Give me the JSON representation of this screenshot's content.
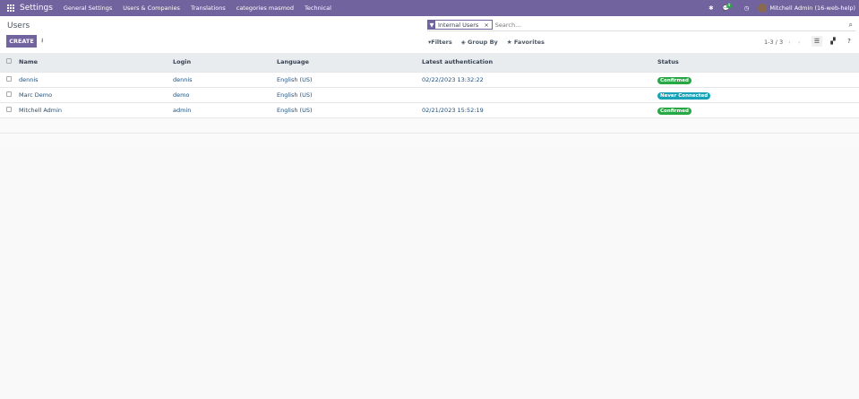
{
  "navbar": {
    "app": "Settings",
    "menus": [
      "General Settings",
      "Users & Companies",
      "Translations",
      "categories masmod",
      "Technical"
    ],
    "chat_count": "4",
    "user": "Mitchell Admin (16-web-help)"
  },
  "page": {
    "title": "Users",
    "create_label": "CREATE"
  },
  "search": {
    "facet": "Internal Users",
    "placeholder": "Search..."
  },
  "filters": {
    "filters": "Filters",
    "group_by": "Group By",
    "favorites": "Favorites"
  },
  "pager": "1-3 / 3",
  "table": {
    "headers": [
      "Name",
      "Login",
      "Language",
      "Latest authentication",
      "Status"
    ],
    "rows": [
      {
        "name": "dennis",
        "login": "dennis",
        "language": "English (US)",
        "auth": "02/22/2023 13:32:22",
        "status": "Confirmed",
        "status_color": "#28a745"
      },
      {
        "name": "Marc Demo",
        "login": "demo",
        "language": "English (US)",
        "auth": "",
        "status": "Never Connected",
        "status_color": "#17a2b8"
      },
      {
        "name": "Mitchell Admin",
        "login": "admin",
        "language": "English (US)",
        "auth": "02/21/2023 15:52:19",
        "status": "Confirmed",
        "status_color": "#28a745"
      }
    ]
  },
  "colors": {
    "brand": "#71639e"
  }
}
